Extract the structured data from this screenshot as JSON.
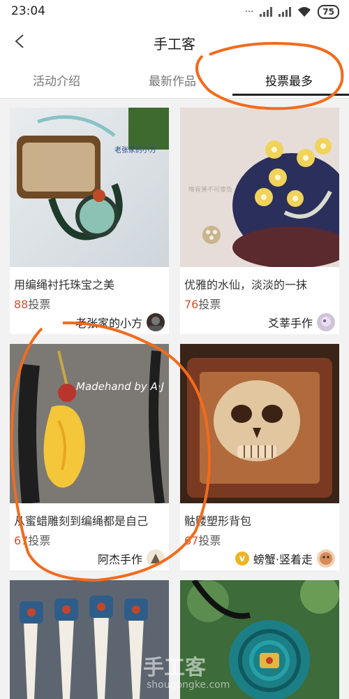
{
  "status": {
    "time": "23:04",
    "battery": "75"
  },
  "nav": {
    "title": "手工客"
  },
  "tabs": [
    {
      "label": "活动介绍"
    },
    {
      "label": "最新作品"
    },
    {
      "label": "投票最多"
    }
  ],
  "cards": [
    {
      "title": "用编绳衬托珠宝之美",
      "votes_num": "88",
      "votes_unit": "投票",
      "author": "老张家的小方",
      "watermark_text": "老张家的小方"
    },
    {
      "title": "优雅的水仙，淡淡的一抹",
      "votes_num": "76",
      "votes_unit": "投票",
      "author": "爻莘手作",
      "watermark_text": "唯有美不可辜负"
    },
    {
      "title": "从蜜蜡雕刻到编绳都是自己",
      "votes_num": "67",
      "votes_unit": "投票",
      "author": "阿杰手作",
      "watermark_text": "Madehand by A·J"
    },
    {
      "title": "骷髅塑形背包",
      "votes_num": "67",
      "votes_unit": "投票",
      "author": "螃蟹·竖着走",
      "badge": "v"
    }
  ],
  "watermark": {
    "main": "手工客",
    "url": "shougongke.com"
  },
  "colors": {
    "accent_vote": "#d0512e",
    "annotation": "#f26b1d"
  }
}
